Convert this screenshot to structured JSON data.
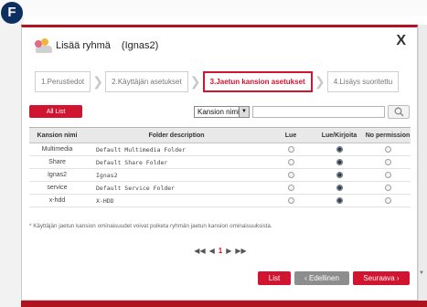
{
  "badge": "F",
  "dialog": {
    "title": "Lisää ryhmä",
    "group_name": "(Ignas2)",
    "close": "X"
  },
  "steps": [
    {
      "label": "1.Perustiedot",
      "active": false
    },
    {
      "label": "2.Käyttäjän asetukset",
      "active": false
    },
    {
      "label": "3.Jaetun kansion asetukset",
      "active": true
    },
    {
      "label": "4.Lisäys suoritettu",
      "active": false
    }
  ],
  "toolbar": {
    "all_list": "All List",
    "filter_select": "Kansion nimi",
    "search_value": ""
  },
  "table": {
    "headers": [
      "Kansion nimi",
      "Folder description",
      "Lue",
      "Lue/Kirjoita",
      "No permission"
    ],
    "rows": [
      {
        "name": "Multimedia",
        "desc": "Default Multimedia Folder",
        "perm": "rw"
      },
      {
        "name": "Share",
        "desc": "Default Share Folder",
        "perm": "rw"
      },
      {
        "name": "Ignas2",
        "desc": "Ignas2",
        "perm": "rw"
      },
      {
        "name": "service",
        "desc": "Default Service Folder",
        "perm": "rw"
      },
      {
        "name": "x-hdd",
        "desc": "X-HDD",
        "perm": "rw"
      }
    ]
  },
  "note": "* Käyttäjän jaetun kansion ominaisuudet voivat poiketa ryhmän jaetun kansion ominaisuuksista.",
  "pager": {
    "first": "◀◀",
    "prev": "◀",
    "current": "1",
    "next": "▶",
    "last": "▶▶"
  },
  "buttons": {
    "list": "List",
    "previous": "‹ Edellinen",
    "next": "Seuraava ›"
  },
  "colors": {
    "accent": "#d1142f",
    "badge": "#0d2e61"
  }
}
